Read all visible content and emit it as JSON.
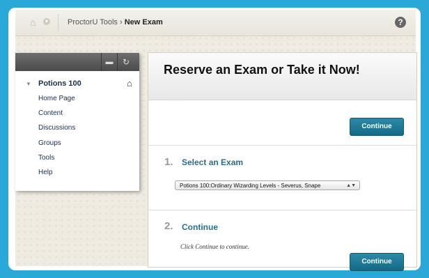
{
  "breadcrumb": {
    "root": "ProctorU Tools",
    "separator": "›",
    "current": "New Exam",
    "help": "?"
  },
  "course_menu": {
    "course_title": "Potions 100",
    "items": [
      "Home Page",
      "Content",
      "Discussions",
      "Groups",
      "Tools",
      "Help"
    ]
  },
  "main": {
    "title": "Reserve an Exam or Take it Now!",
    "continue_top": "Continue",
    "step1": {
      "number": "1.",
      "title": "Select an Exam",
      "selected_exam": "Potions 100:Ordinary Wizarding Levels - Severus, Snape"
    },
    "step2": {
      "number": "2.",
      "title": "Continue",
      "hint": "Click Continue to continue.",
      "button": "Continue"
    }
  },
  "colors": {
    "frame_bg": "#2aa9d9",
    "accent_button": "#1c7b99",
    "link": "#2b6e8c",
    "nav_text": "#1b2e4e"
  }
}
